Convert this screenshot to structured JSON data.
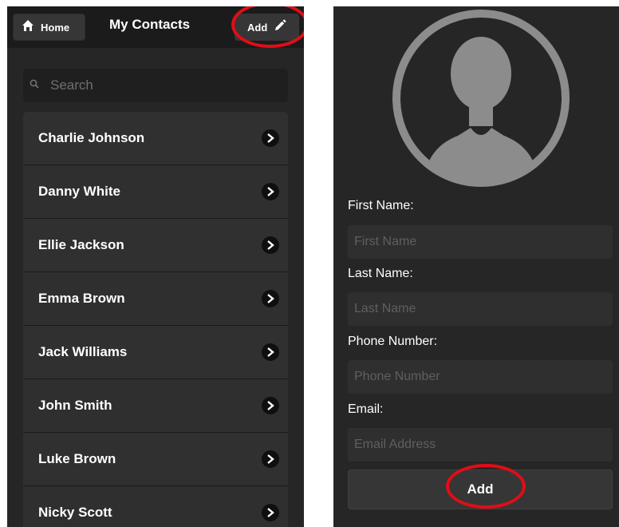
{
  "header": {
    "home_label": "Home",
    "title": "My Contacts",
    "add_label": "Add"
  },
  "search": {
    "placeholder": "Search"
  },
  "contacts": [
    {
      "name": "Charlie Johnson"
    },
    {
      "name": "Danny White"
    },
    {
      "name": "Ellie Jackson"
    },
    {
      "name": "Emma Brown"
    },
    {
      "name": "Jack Williams"
    },
    {
      "name": "John Smith"
    },
    {
      "name": "Luke Brown"
    },
    {
      "name": "Nicky Scott"
    }
  ],
  "form": {
    "first_name_label": "First Name:",
    "first_name_placeholder": "First Name",
    "last_name_label": "Last Name:",
    "last_name_placeholder": "Last Name",
    "phone_label": "Phone Number:",
    "phone_placeholder": "Phone Number",
    "email_label": "Email:",
    "email_placeholder": "Email Address",
    "submit_label": "Add"
  },
  "colors": {
    "highlight": "#e10d17",
    "panel_bg": "#262626",
    "header_bg": "#1b1b1b",
    "avatar": "#8c8c8c"
  },
  "icons": {
    "home": "home-icon",
    "edit": "pencil-icon",
    "search": "search-icon",
    "chevron": "chevron-right-icon",
    "avatar": "user-avatar-icon"
  }
}
